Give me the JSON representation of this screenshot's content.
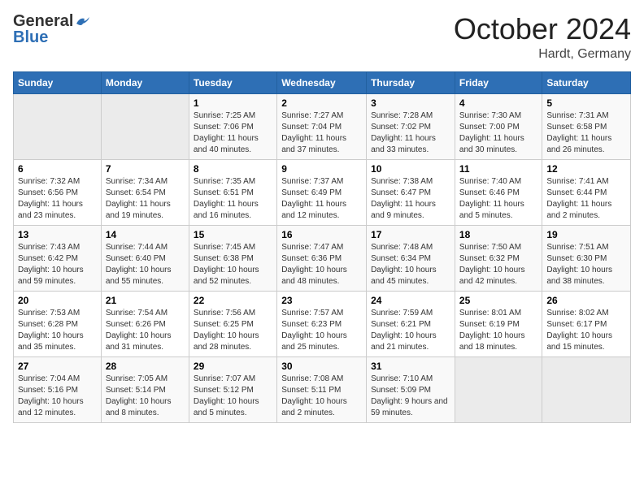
{
  "header": {
    "logo_general": "General",
    "logo_blue": "Blue",
    "month_title": "October 2024",
    "location": "Hardt, Germany"
  },
  "weekdays": [
    "Sunday",
    "Monday",
    "Tuesday",
    "Wednesday",
    "Thursday",
    "Friday",
    "Saturday"
  ],
  "weeks": [
    [
      {
        "day": "",
        "sunrise": "",
        "sunset": "",
        "daylight": ""
      },
      {
        "day": "",
        "sunrise": "",
        "sunset": "",
        "daylight": ""
      },
      {
        "day": "1",
        "sunrise": "Sunrise: 7:25 AM",
        "sunset": "Sunset: 7:06 PM",
        "daylight": "Daylight: 11 hours and 40 minutes."
      },
      {
        "day": "2",
        "sunrise": "Sunrise: 7:27 AM",
        "sunset": "Sunset: 7:04 PM",
        "daylight": "Daylight: 11 hours and 37 minutes."
      },
      {
        "day": "3",
        "sunrise": "Sunrise: 7:28 AM",
        "sunset": "Sunset: 7:02 PM",
        "daylight": "Daylight: 11 hours and 33 minutes."
      },
      {
        "day": "4",
        "sunrise": "Sunrise: 7:30 AM",
        "sunset": "Sunset: 7:00 PM",
        "daylight": "Daylight: 11 hours and 30 minutes."
      },
      {
        "day": "5",
        "sunrise": "Sunrise: 7:31 AM",
        "sunset": "Sunset: 6:58 PM",
        "daylight": "Daylight: 11 hours and 26 minutes."
      }
    ],
    [
      {
        "day": "6",
        "sunrise": "Sunrise: 7:32 AM",
        "sunset": "Sunset: 6:56 PM",
        "daylight": "Daylight: 11 hours and 23 minutes."
      },
      {
        "day": "7",
        "sunrise": "Sunrise: 7:34 AM",
        "sunset": "Sunset: 6:54 PM",
        "daylight": "Daylight: 11 hours and 19 minutes."
      },
      {
        "day": "8",
        "sunrise": "Sunrise: 7:35 AM",
        "sunset": "Sunset: 6:51 PM",
        "daylight": "Daylight: 11 hours and 16 minutes."
      },
      {
        "day": "9",
        "sunrise": "Sunrise: 7:37 AM",
        "sunset": "Sunset: 6:49 PM",
        "daylight": "Daylight: 11 hours and 12 minutes."
      },
      {
        "day": "10",
        "sunrise": "Sunrise: 7:38 AM",
        "sunset": "Sunset: 6:47 PM",
        "daylight": "Daylight: 11 hours and 9 minutes."
      },
      {
        "day": "11",
        "sunrise": "Sunrise: 7:40 AM",
        "sunset": "Sunset: 6:46 PM",
        "daylight": "Daylight: 11 hours and 5 minutes."
      },
      {
        "day": "12",
        "sunrise": "Sunrise: 7:41 AM",
        "sunset": "Sunset: 6:44 PM",
        "daylight": "Daylight: 11 hours and 2 minutes."
      }
    ],
    [
      {
        "day": "13",
        "sunrise": "Sunrise: 7:43 AM",
        "sunset": "Sunset: 6:42 PM",
        "daylight": "Daylight: 10 hours and 59 minutes."
      },
      {
        "day": "14",
        "sunrise": "Sunrise: 7:44 AM",
        "sunset": "Sunset: 6:40 PM",
        "daylight": "Daylight: 10 hours and 55 minutes."
      },
      {
        "day": "15",
        "sunrise": "Sunrise: 7:45 AM",
        "sunset": "Sunset: 6:38 PM",
        "daylight": "Daylight: 10 hours and 52 minutes."
      },
      {
        "day": "16",
        "sunrise": "Sunrise: 7:47 AM",
        "sunset": "Sunset: 6:36 PM",
        "daylight": "Daylight: 10 hours and 48 minutes."
      },
      {
        "day": "17",
        "sunrise": "Sunrise: 7:48 AM",
        "sunset": "Sunset: 6:34 PM",
        "daylight": "Daylight: 10 hours and 45 minutes."
      },
      {
        "day": "18",
        "sunrise": "Sunrise: 7:50 AM",
        "sunset": "Sunset: 6:32 PM",
        "daylight": "Daylight: 10 hours and 42 minutes."
      },
      {
        "day": "19",
        "sunrise": "Sunrise: 7:51 AM",
        "sunset": "Sunset: 6:30 PM",
        "daylight": "Daylight: 10 hours and 38 minutes."
      }
    ],
    [
      {
        "day": "20",
        "sunrise": "Sunrise: 7:53 AM",
        "sunset": "Sunset: 6:28 PM",
        "daylight": "Daylight: 10 hours and 35 minutes."
      },
      {
        "day": "21",
        "sunrise": "Sunrise: 7:54 AM",
        "sunset": "Sunset: 6:26 PM",
        "daylight": "Daylight: 10 hours and 31 minutes."
      },
      {
        "day": "22",
        "sunrise": "Sunrise: 7:56 AM",
        "sunset": "Sunset: 6:25 PM",
        "daylight": "Daylight: 10 hours and 28 minutes."
      },
      {
        "day": "23",
        "sunrise": "Sunrise: 7:57 AM",
        "sunset": "Sunset: 6:23 PM",
        "daylight": "Daylight: 10 hours and 25 minutes."
      },
      {
        "day": "24",
        "sunrise": "Sunrise: 7:59 AM",
        "sunset": "Sunset: 6:21 PM",
        "daylight": "Daylight: 10 hours and 21 minutes."
      },
      {
        "day": "25",
        "sunrise": "Sunrise: 8:01 AM",
        "sunset": "Sunset: 6:19 PM",
        "daylight": "Daylight: 10 hours and 18 minutes."
      },
      {
        "day": "26",
        "sunrise": "Sunrise: 8:02 AM",
        "sunset": "Sunset: 6:17 PM",
        "daylight": "Daylight: 10 hours and 15 minutes."
      }
    ],
    [
      {
        "day": "27",
        "sunrise": "Sunrise: 7:04 AM",
        "sunset": "Sunset: 5:16 PM",
        "daylight": "Daylight: 10 hours and 12 minutes."
      },
      {
        "day": "28",
        "sunrise": "Sunrise: 7:05 AM",
        "sunset": "Sunset: 5:14 PM",
        "daylight": "Daylight: 10 hours and 8 minutes."
      },
      {
        "day": "29",
        "sunrise": "Sunrise: 7:07 AM",
        "sunset": "Sunset: 5:12 PM",
        "daylight": "Daylight: 10 hours and 5 minutes."
      },
      {
        "day": "30",
        "sunrise": "Sunrise: 7:08 AM",
        "sunset": "Sunset: 5:11 PM",
        "daylight": "Daylight: 10 hours and 2 minutes."
      },
      {
        "day": "31",
        "sunrise": "Sunrise: 7:10 AM",
        "sunset": "Sunset: 5:09 PM",
        "daylight": "Daylight: 9 hours and 59 minutes."
      },
      {
        "day": "",
        "sunrise": "",
        "sunset": "",
        "daylight": ""
      },
      {
        "day": "",
        "sunrise": "",
        "sunset": "",
        "daylight": ""
      }
    ]
  ]
}
